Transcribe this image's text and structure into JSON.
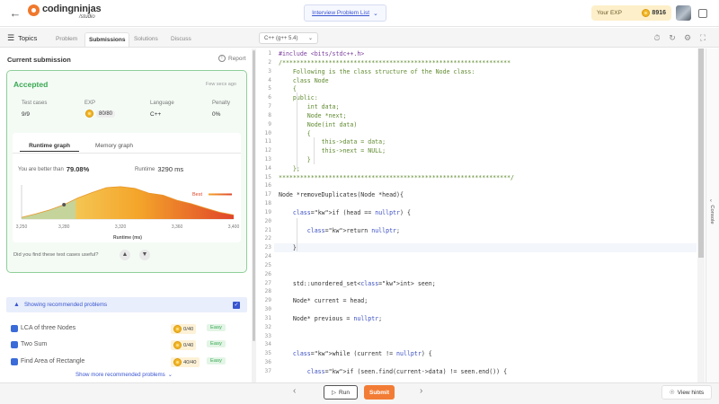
{
  "header": {
    "logo_text": "codingninjas",
    "logo_sub": "/studio",
    "problem_list": "Interview Problem List",
    "exp_label": "Your EXP",
    "exp_value": "8916"
  },
  "toolbar": {
    "topics": "Topics",
    "tabs": [
      "Problem",
      "Submissions",
      "Solutions",
      "Discuss"
    ],
    "language": "C++ (g++ 5.4)"
  },
  "submission": {
    "heading": "Current submission",
    "report": "Report",
    "status": "Accepted",
    "when": "Few secs ago",
    "stats": [
      {
        "label": "Test cases",
        "value": "9/9"
      },
      {
        "label": "EXP",
        "value": "80/80"
      },
      {
        "label": "Language",
        "value": "C++"
      },
      {
        "label": "Penalty",
        "value": "0%"
      }
    ],
    "graph_tabs": [
      "Runtime graph",
      "Memory graph"
    ],
    "better_than_label": "You are better than",
    "better_than_value": "79.08%",
    "runtime_label": "Runtime",
    "runtime_value": "3290 ms",
    "useful_question": "Did you find these test cases useful?"
  },
  "chart_data": {
    "type": "area",
    "x": [
      3250,
      3260,
      3270,
      3280,
      3290,
      3300,
      3310,
      3320,
      3330,
      3340,
      3350,
      3360,
      3370,
      3380,
      3390,
      3400
    ],
    "y": [
      0.05,
      0.15,
      0.27,
      0.42,
      0.62,
      0.78,
      0.92,
      0.95,
      0.9,
      0.76,
      0.7,
      0.55,
      0.45,
      0.32,
      0.2,
      0.12
    ],
    "x_ticks": [
      "3,250",
      "3,280",
      "3,320",
      "3,360",
      "3,400"
    ],
    "xlabel": "Runtime (ms)",
    "marker_x": 3280,
    "best_label": "Best",
    "colors": {
      "low": "#c5d49a",
      "high": "#f4a52a",
      "worst": "#e0452a"
    }
  },
  "recommended": {
    "heading": "Showing recommended problems",
    "items": [
      {
        "name": "LCA of three Nodes",
        "score": "0/40",
        "difficulty": "Easy"
      },
      {
        "name": "Two Sum",
        "score": "0/40",
        "difficulty": "Easy"
      },
      {
        "name": "Find Area of Rectangle",
        "score": "40/40",
        "difficulty": "Easy"
      }
    ],
    "show_more": "Show more recommended problems"
  },
  "editor": {
    "lines": [
      {
        "n": "1",
        "text": "#include <bits/stdc++.h>"
      },
      {
        "n": "2",
        "text": "/****************************************************************"
      },
      {
        "n": "3",
        "text": "    Following is the class structure of the Node class:"
      },
      {
        "n": "4",
        "text": "    class Node"
      },
      {
        "n": "5",
        "text": "    {"
      },
      {
        "n": "6",
        "text": "    public:"
      },
      {
        "n": "7",
        "text": "        int data;"
      },
      {
        "n": "8",
        "text": "        Node *next;"
      },
      {
        "n": "9",
        "text": "        Node(int data)"
      },
      {
        "n": "10",
        "text": "        {"
      },
      {
        "n": "11",
        "text": "            this->data = data;"
      },
      {
        "n": "12",
        "text": "            this->next = NULL;"
      },
      {
        "n": "13",
        "text": "        }"
      },
      {
        "n": "14",
        "text": "    };"
      },
      {
        "n": "15",
        "text": "*****************************************************************/"
      },
      {
        "n": "16",
        "text": ""
      },
      {
        "n": "17",
        "text": "Node *removeDuplicates(Node *head){"
      },
      {
        "n": "18",
        "text": ""
      },
      {
        "n": "19",
        "text": "    if (head == nullptr) {"
      },
      {
        "n": "20",
        "text": ""
      },
      {
        "n": "21",
        "text": "        return nullptr;"
      },
      {
        "n": "22",
        "text": ""
      },
      {
        "n": "23",
        "text": "    }"
      },
      {
        "n": "24",
        "text": ""
      },
      {
        "n": "25",
        "text": ""
      },
      {
        "n": "26",
        "text": ""
      },
      {
        "n": "27",
        "text": "    std::unordered_set<int> seen;"
      },
      {
        "n": "28",
        "text": ""
      },
      {
        "n": "29",
        "text": "    Node* current = head;"
      },
      {
        "n": "30",
        "text": ""
      },
      {
        "n": "31",
        "text": "    Node* previous = nullptr;"
      },
      {
        "n": "32",
        "text": ""
      },
      {
        "n": "33",
        "text": ""
      },
      {
        "n": "34",
        "text": ""
      },
      {
        "n": "35",
        "text": "    while (current != nullptr) {"
      },
      {
        "n": "36",
        "text": ""
      },
      {
        "n": "37",
        "text": "        if (seen.find(current->data) != seen.end()) {"
      }
    ],
    "console": "Console"
  },
  "bottom": {
    "run": "Run",
    "submit": "Submit",
    "hints": "View hints"
  }
}
